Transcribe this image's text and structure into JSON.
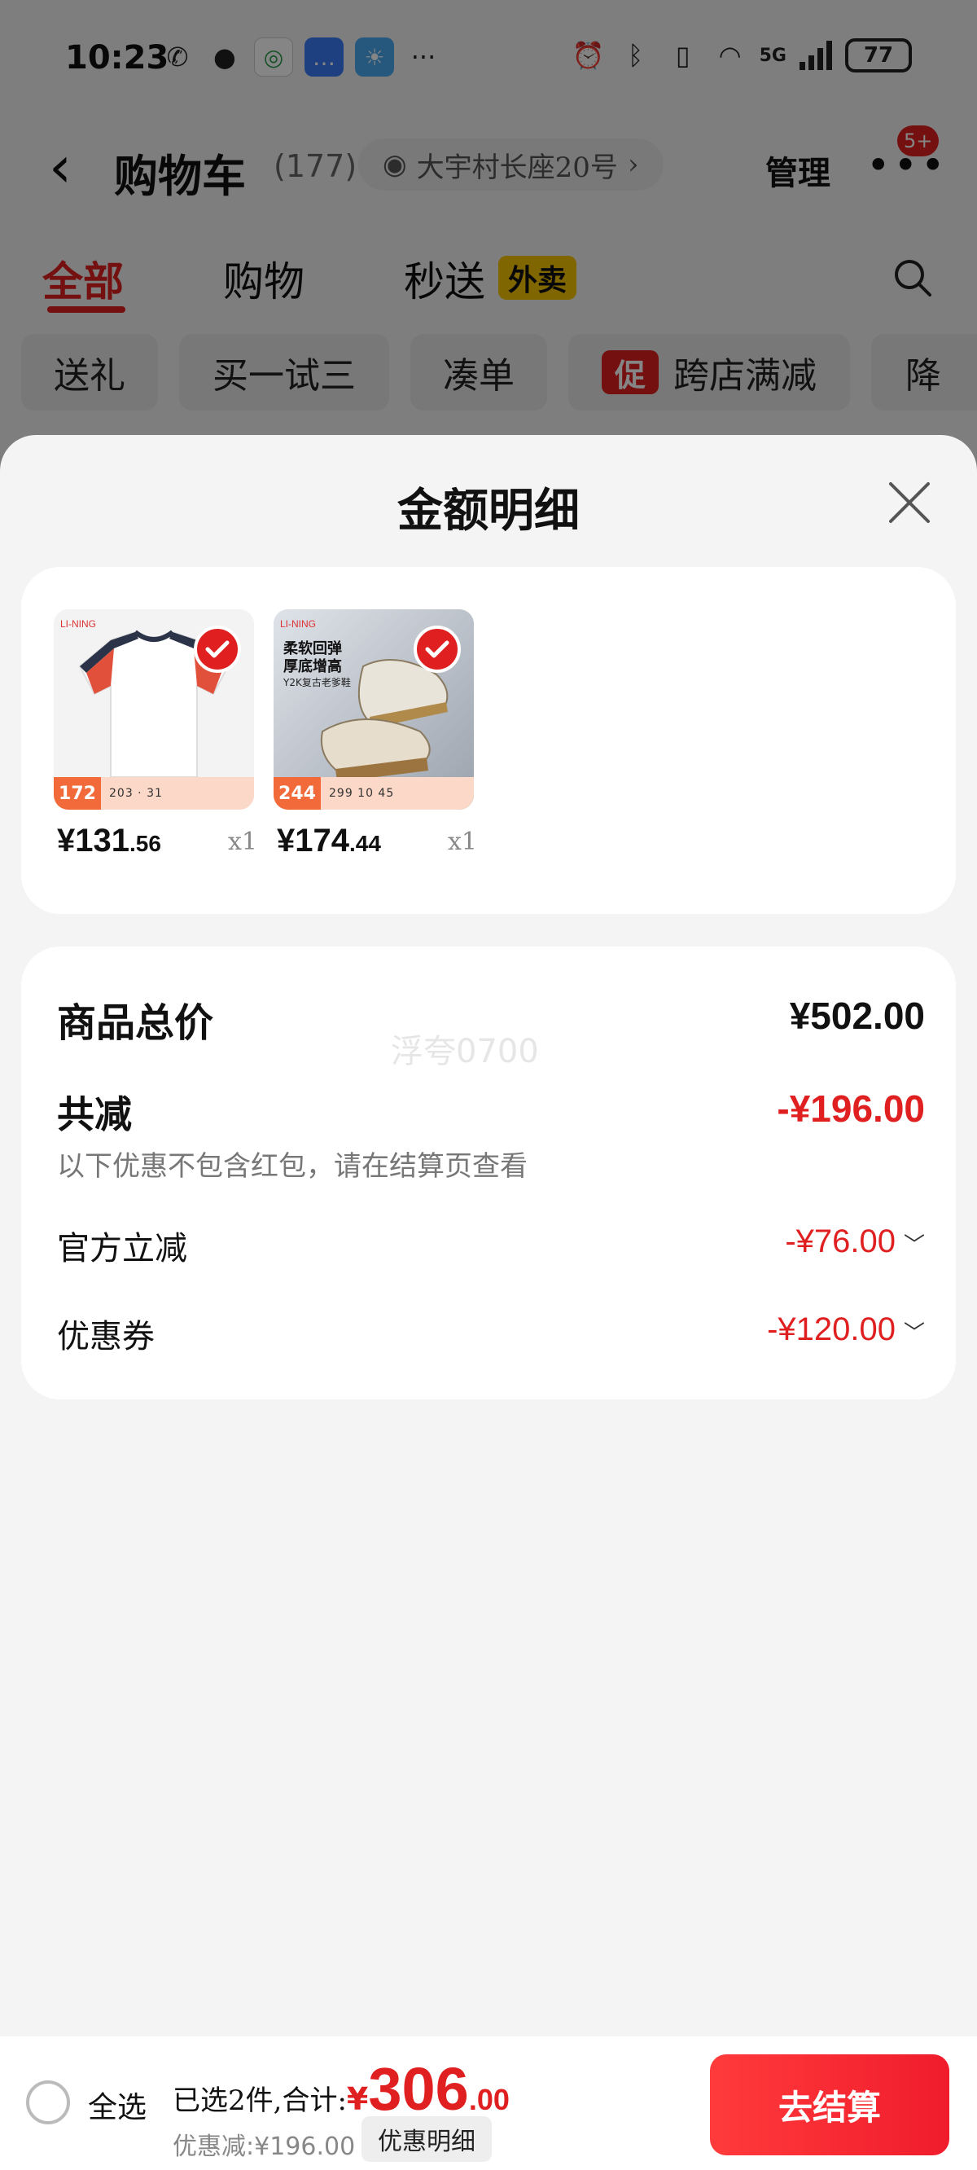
{
  "status_bar": {
    "time": "10:23",
    "network": "5G",
    "battery": "77",
    "more": "···"
  },
  "nav": {
    "title": "购物车",
    "count": "(177)",
    "address": "大宇村长座20号",
    "manage": "管理",
    "more_badge": "5+"
  },
  "tabs": [
    {
      "label": "全部"
    },
    {
      "label": "购物"
    },
    {
      "label": "秒送"
    }
  ],
  "takeout_badge": "外卖",
  "chips": [
    {
      "label": "送礼"
    },
    {
      "label": "买一试三"
    },
    {
      "label": "凑单"
    },
    {
      "label": "跨店满减"
    },
    {
      "label": "降"
    }
  ],
  "promo_mark": "促",
  "sheet": {
    "title": "金额明细",
    "products": [
      {
        "price_int": "¥131",
        "price_dec": ".56",
        "qty": "x1",
        "strip_price": "172",
        "strip_nums": "203 · 31"
      },
      {
        "price_int": "¥174",
        "price_dec": ".44",
        "qty": "x1",
        "strip_price": "244",
        "strip_nums": "299  10  45",
        "promo_text_1": "柔软回弹",
        "promo_text_2": "厚底增高",
        "promo_text_3": "Y2K复古老爹鞋"
      }
    ],
    "watermark": "浮夸0700",
    "summary": {
      "total_label": "商品总价",
      "total_value": "¥502.00",
      "reduce_label": "共减",
      "reduce_value": "-¥196.00",
      "reduce_note": "以下优惠不包含红包，请在结算页查看",
      "official_label": "官方立减",
      "official_value": "-¥76.00",
      "coupon_label": "优惠券",
      "coupon_value": "-¥120.00"
    }
  },
  "bottom": {
    "select_all": "全选",
    "selected_prefix": "已选2件,合计:",
    "yen": "¥",
    "total_int": "306",
    "total_dec": ".00",
    "discount": "优惠减:¥196.00",
    "detail_button": "优惠明细",
    "checkout": "去结算"
  },
  "colors": {
    "accent": "#e02020",
    "sheet_bg": "#f4f4f4",
    "card_bg": "#ffffff"
  }
}
